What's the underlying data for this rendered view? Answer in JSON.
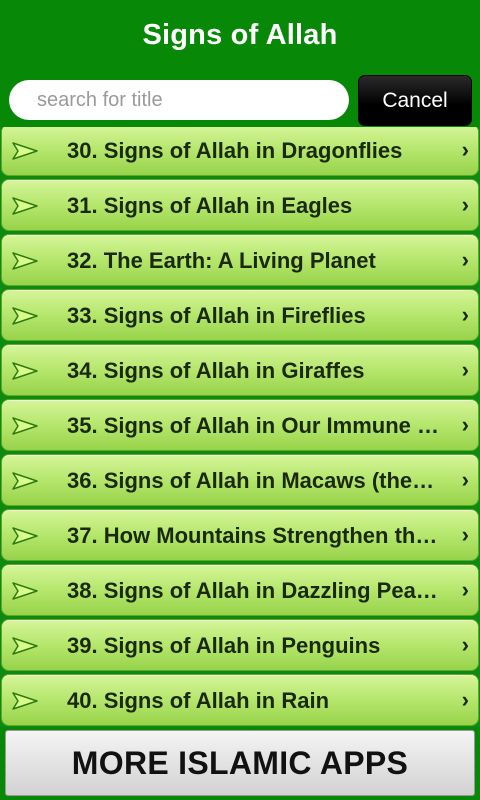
{
  "header": {
    "title": "Signs of Allah"
  },
  "search": {
    "placeholder": "search for title",
    "value": "",
    "cancel_label": "Cancel"
  },
  "list": {
    "items": [
      {
        "label": "30. Signs of Allah in Dragonflies"
      },
      {
        "label": "31. Signs of Allah in Eagles"
      },
      {
        "label": "32. The Earth: A Living Planet"
      },
      {
        "label": "33. Signs of Allah in Fireflies"
      },
      {
        "label": "34. Signs of Allah in Giraffes"
      },
      {
        "label": "35. Signs of Allah in Our Immune …"
      },
      {
        "label": "36. Signs of Allah in Macaws (the…"
      },
      {
        "label": "37. How Mountains Strengthen th…"
      },
      {
        "label": "38. Signs of Allah in Dazzling Pea…"
      },
      {
        "label": "39. Signs of Allah in Penguins"
      },
      {
        "label": "40. Signs of Allah in Rain"
      }
    ],
    "row_icon": "play-arrow-icon",
    "row_chevron": "›"
  },
  "footer": {
    "button_label": "MORE ISLAMIC APPS"
  },
  "colors": {
    "background": "#078807",
    "row_light": "#d6f59a",
    "row_dark": "#98d34a"
  }
}
